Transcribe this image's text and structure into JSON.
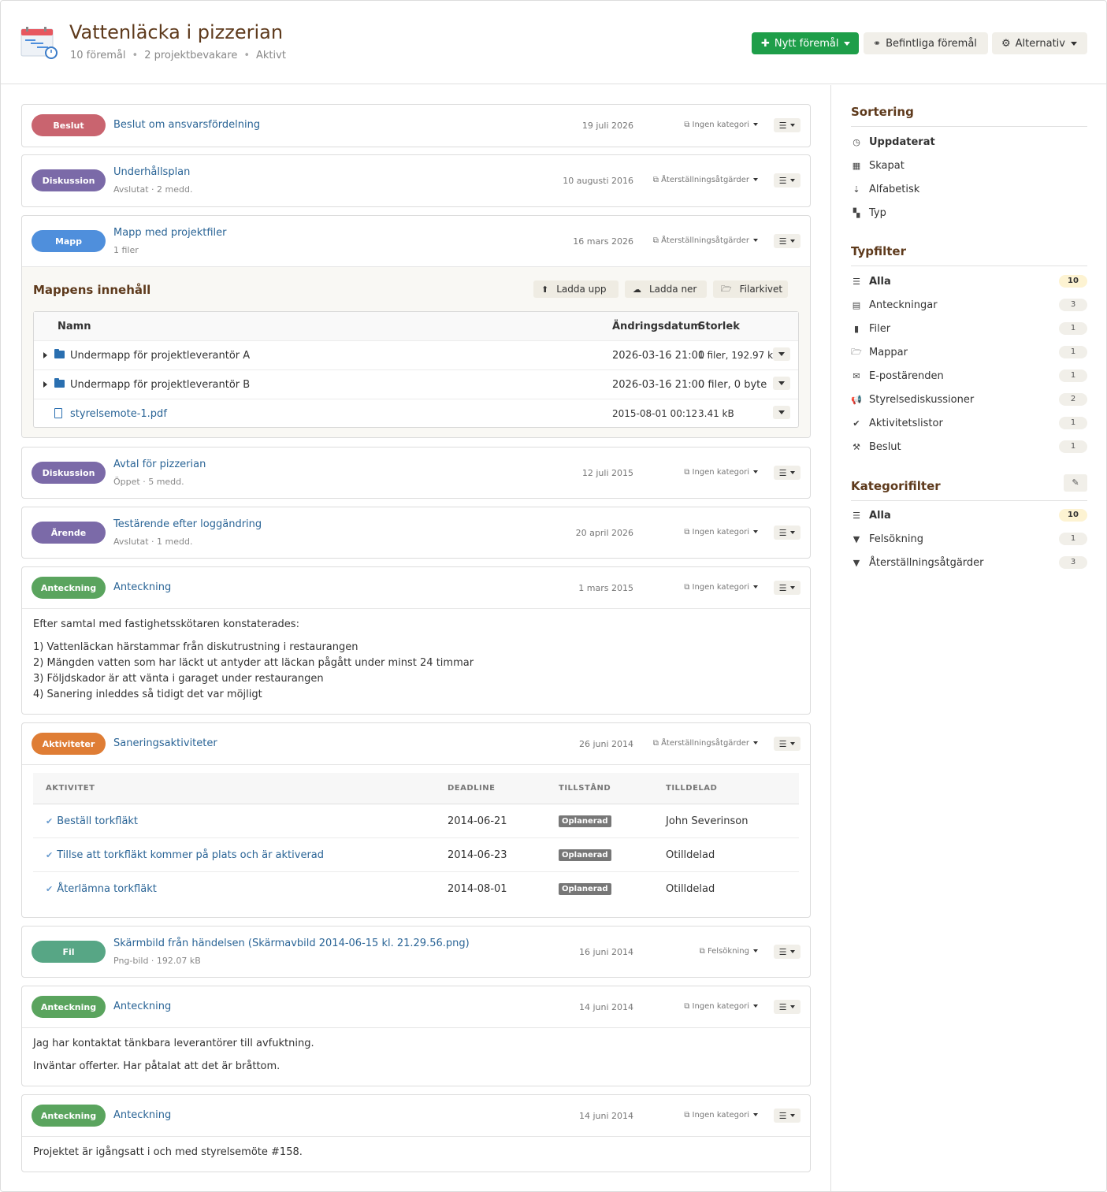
{
  "header": {
    "title": "Vattenläcka i pizzerian",
    "meta": [
      "10 föremål",
      "2 projektbevakare",
      "Aktivt"
    ],
    "new_button": "Nytt föremål",
    "existing_button": "Befintliga föremål",
    "options_button": "Alternativ"
  },
  "colors": {
    "accent_brown": "#5e3a1c",
    "link_blue": "#2a6496",
    "green_button": "#1e9e49",
    "badge_beslut": "#c9646f",
    "badge_diskussion": "#7b6aa8",
    "badge_mapp": "#4f8fdc",
    "badge_anteckning": "#5aa45e",
    "badge_aktiviteter": "#df7d35",
    "badge_fil": "#57a685"
  },
  "items": [
    {
      "badge": "Beslut",
      "title": "Beslut om ansvarsfördelning",
      "sub": "",
      "date": "19 juli 2026",
      "category": "Ingen kategori"
    },
    {
      "badge": "Diskussion",
      "title": "Underhållsplan",
      "sub": "Avslutat · 2 medd.",
      "date": "10 augusti 2016",
      "category": "Återställningsåtgärder"
    },
    {
      "badge": "Mapp",
      "title": "Mapp med projektfiler",
      "sub": "1 filer",
      "date": "16 mars 2026",
      "category": "Återställningsåtgärder"
    },
    {
      "badge": "Diskussion",
      "title": "Avtal för pizzerian",
      "sub": "Öppet · 5 medd.",
      "date": "12 juli 2015",
      "category": "Ingen kategori"
    },
    {
      "badge": "Ärende",
      "title": "Testärende efter loggändring",
      "sub": "Avslutat · 1 medd.",
      "date": "20 april 2026",
      "category": "Ingen kategori"
    },
    {
      "badge": "Anteckning",
      "title": "Anteckning",
      "sub": "",
      "date": "1 mars 2015",
      "category": "Ingen kategori"
    },
    {
      "badge": "Aktiviteter",
      "title": "Saneringsaktiviteter",
      "sub": "",
      "date": "26 juni 2014",
      "category": "Återställningsåtgärder"
    },
    {
      "badge": "Fil",
      "title": "Skärmbild från händelsen (Skärmavbild 2014-06-15 kl. 21.29.56.png)",
      "sub": "Png-bild · 192.07 kB",
      "date": "16 juni 2014",
      "category": "Felsökning"
    },
    {
      "badge": "Anteckning",
      "title": "Anteckning",
      "sub": "",
      "date": "14 juni 2014",
      "category": "Ingen kategori"
    },
    {
      "badge": "Anteckning",
      "title": "Anteckning",
      "sub": "",
      "date": "14 juni 2014",
      "category": "Ingen kategori"
    }
  ],
  "folder": {
    "title": "Mappens innehåll",
    "upload": "Ladda upp",
    "download": "Ladda ner",
    "archive": "Filarkivet",
    "columns": [
      "Namn",
      "Ändringsdatum",
      "Storlek"
    ],
    "rows": [
      {
        "name": "Undermapp för projektleverantör A",
        "date": "2026-03-16 21:00",
        "size": "1 filer, 192.97 kB"
      },
      {
        "name": "Undermapp för projektleverantör B",
        "date": "2026-03-16 21:00",
        "size": "0 filer, 0 byte"
      },
      {
        "name": "styrelsemote-1.pdf",
        "date": "2015-08-01 00:12",
        "size": "3.41 kB"
      }
    ]
  },
  "note1": {
    "lines": [
      "Efter samtal med fastighetsskötaren konstaterades:",
      "1) Vattenläckan härstammar från diskutrustning i restaurangen",
      "2) Mängden vatten som har läckt ut antyder att läckan pågått under minst 24 timmar",
      "3) Följdskador är att vänta i garaget under restaurangen",
      "4) Sanering inleddes så tidigt det var möjligt"
    ]
  },
  "activities": {
    "columns": [
      "AKTIVITET",
      "DEADLINE",
      "TILLSTÅND",
      "TILLDELAD"
    ],
    "rows": [
      {
        "name": "Beställ torkfläkt",
        "deadline": "2014-06-21",
        "state": "Oplanerad",
        "assigned": "John Severinson"
      },
      {
        "name": "Tillse att torkfläkt kommer på plats och är aktiverad",
        "deadline": "2014-06-23",
        "state": "Oplanerad",
        "assigned": "Otilldelad"
      },
      {
        "name": "Återlämna torkfläkt",
        "deadline": "2014-08-01",
        "state": "Oplanerad",
        "assigned": "Otilldelad"
      }
    ]
  },
  "note2": {
    "lines": [
      "Jag har kontaktat tänkbara leverantörer till avfuktning.",
      "Inväntar offerter. Har påtalat att det är bråttom."
    ]
  },
  "note3": {
    "lines": [
      "Projektet är igångsatt i och med styrelsemöte #158."
    ]
  },
  "sidebar": {
    "sorting_title": "Sortering",
    "sorting": [
      "Uppdaterat",
      "Skapat",
      "Alfabetisk",
      "Typ"
    ],
    "typefilter_title": "Typfilter",
    "typefilter": [
      {
        "label": "Alla",
        "count": "10"
      },
      {
        "label": "Anteckningar",
        "count": "3"
      },
      {
        "label": "Filer",
        "count": "1"
      },
      {
        "label": "Mappar",
        "count": "1"
      },
      {
        "label": "E-postärenden",
        "count": "1"
      },
      {
        "label": "Styrelsediskussioner",
        "count": "2"
      },
      {
        "label": "Aktivitetslistor",
        "count": "1"
      },
      {
        "label": "Beslut",
        "count": "1"
      }
    ],
    "categoryfilter_title": "Kategorifilter",
    "categoryfilter": [
      {
        "label": "Alla",
        "count": "10"
      },
      {
        "label": "Felsökning",
        "count": "1"
      },
      {
        "label": "Återställningsåtgärder",
        "count": "3"
      }
    ]
  }
}
